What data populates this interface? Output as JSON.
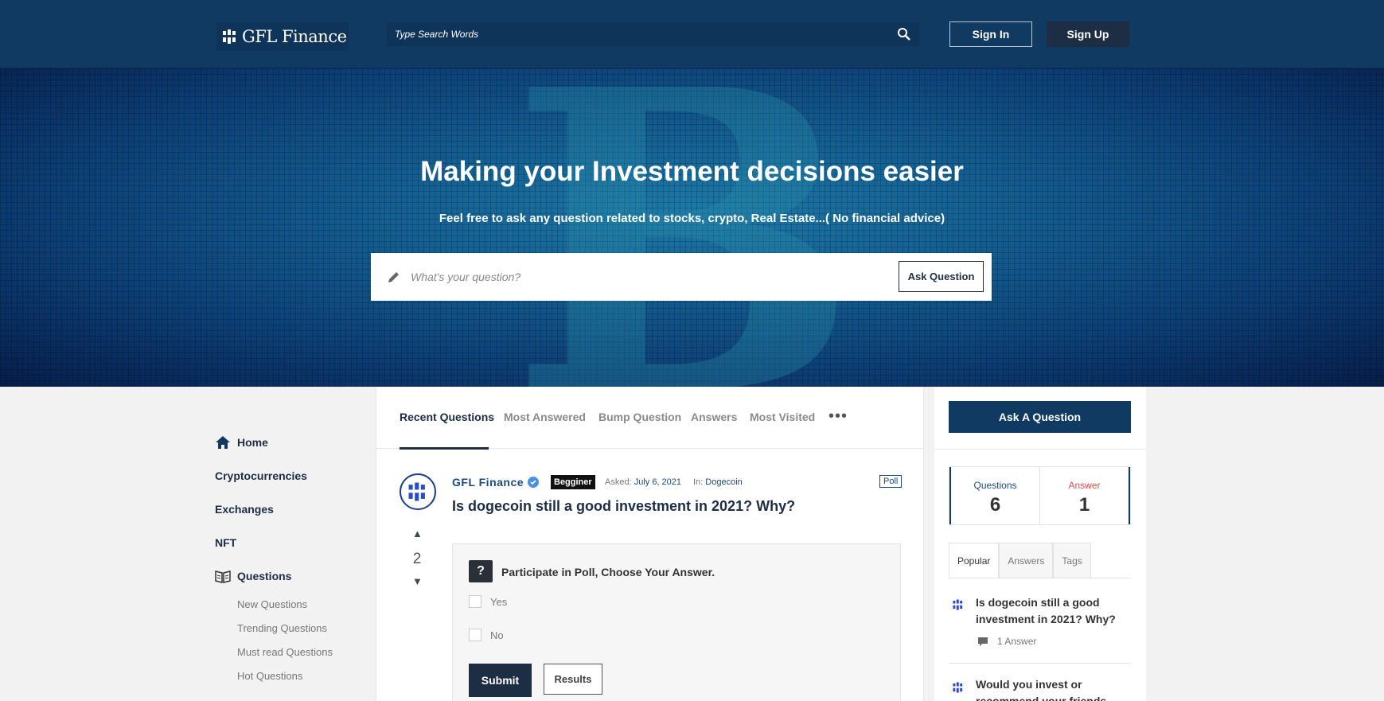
{
  "header": {
    "logo_text": "GFL Finance",
    "search_placeholder": "Type Search Words",
    "sign_in": "Sign In",
    "sign_up": "Sign Up"
  },
  "hero": {
    "title": "Making your Investment decisions easier",
    "subtitle": "Feel free to ask any question related to stocks, crypto, Real Estate...( No financial advice)",
    "ask_placeholder": "What's your question?",
    "ask_button": "Ask Question"
  },
  "sidebar": {
    "items": [
      {
        "label": "Home",
        "icon": "home-icon"
      },
      {
        "label": "Cryptocurrencies"
      },
      {
        "label": "Exchanges"
      },
      {
        "label": "NFT"
      },
      {
        "label": "Questions",
        "icon": "book-icon"
      }
    ],
    "sub_items": [
      "New Questions",
      "Trending Questions",
      "Must read Questions",
      "Hot Questions"
    ]
  },
  "main": {
    "tabs": [
      "Recent Questions",
      "Most Answered",
      "Bump Question",
      "Answers",
      "Most Visited"
    ],
    "more": "•••",
    "question": {
      "author": "GFL Finance",
      "badge": "Begginer",
      "asked_label": "Asked:",
      "asked_date": "July 6, 2021",
      "in_label": "In:",
      "category": "Dogecoin",
      "type_badge": "Poll",
      "title": "Is dogecoin still a good investment in 2021? Why?",
      "votes": "2",
      "poll": {
        "title": "Participate in Poll, Choose Your Answer.",
        "options": [
          "Yes",
          "No"
        ],
        "submit": "Submit",
        "results": "Results"
      }
    }
  },
  "right": {
    "ask_button": "Ask A Question",
    "stats": [
      {
        "label": "Questions",
        "value": "6",
        "color": "#1b4a7d"
      },
      {
        "label": "Answer",
        "value": "1",
        "color": "#e04b4b"
      }
    ],
    "tabs": [
      "Popular",
      "Answers",
      "Tags"
    ],
    "popular": [
      {
        "title": "Is dogecoin still a good investment in 2021? Why?",
        "meta": "1 Answer"
      },
      {
        "title": "Would you invest or recommend your friends to"
      }
    ]
  },
  "colors": {
    "header_bg": "#113a63",
    "accent_dark": "#1d2d44",
    "link_blue": "#1b4a7d"
  }
}
